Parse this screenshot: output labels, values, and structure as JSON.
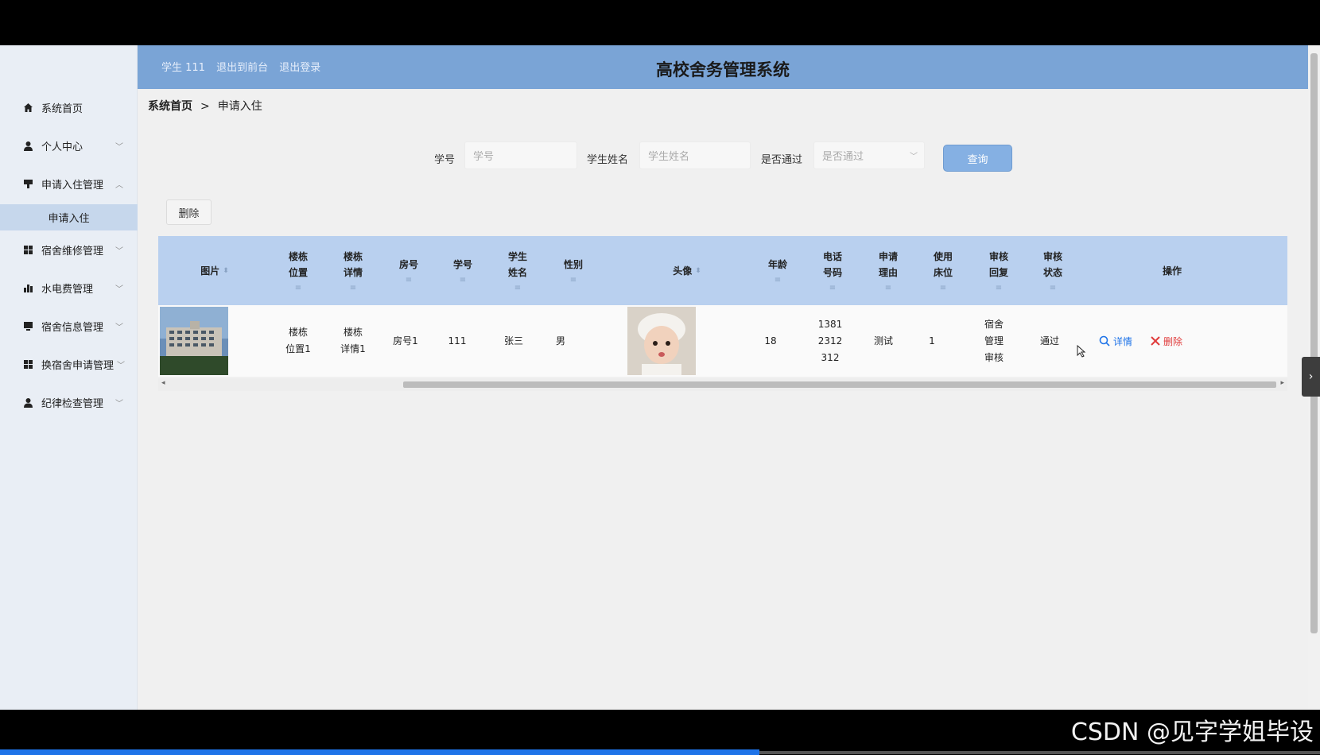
{
  "header": {
    "user_label": "学生 111",
    "back_link": "退出到前台",
    "logout_link": "退出登录",
    "title": "高校舍务管理系统"
  },
  "sidebar": {
    "items": [
      {
        "label": "系统首页",
        "icon": "home-icon"
      },
      {
        "label": "个人中心",
        "icon": "user-icon"
      },
      {
        "label": "申请入住管理",
        "icon": "bookmark-icon"
      },
      {
        "label": "宿舍维修管理",
        "icon": "grid-icon"
      },
      {
        "label": "水电费管理",
        "icon": "bar-chart-icon"
      },
      {
        "label": "宿舍信息管理",
        "icon": "monitor-icon"
      },
      {
        "label": "换宿舍申请管理",
        "icon": "grid-icon"
      },
      {
        "label": "纪律检查管理",
        "icon": "user-icon"
      }
    ],
    "active_sub": "申请入住"
  },
  "breadcrumb": {
    "home": "系统首页",
    "separator": ">",
    "current": "申请入住"
  },
  "search": {
    "student_id_label": "学号",
    "student_id_placeholder": "学号",
    "student_name_label": "学生姓名",
    "student_name_placeholder": "学生姓名",
    "passed_label": "是否通过",
    "passed_placeholder": "是否通过",
    "query_button": "查询"
  },
  "toolbar": {
    "delete_button": "删除"
  },
  "table": {
    "headers": {
      "image": "图片",
      "building_location": [
        "楼栋",
        "位置"
      ],
      "building_detail": [
        "楼栋",
        "详情"
      ],
      "room": "房号",
      "student_id": "学号",
      "student_name": [
        "学生",
        "姓名"
      ],
      "gender": "性别",
      "avatar": "头像",
      "age": "年龄",
      "phone": [
        "电话",
        "号码"
      ],
      "reason": [
        "申请",
        "理由"
      ],
      "bed": [
        "使用",
        "床位"
      ],
      "review_reply": [
        "审核",
        "回复"
      ],
      "review_status": [
        "审核",
        "状态"
      ],
      "actions": "操作"
    },
    "rows": [
      {
        "building_location": [
          "楼栋",
          "位置1"
        ],
        "building_detail": [
          "楼栋",
          "详情1"
        ],
        "room": "房号1",
        "student_id": "111",
        "student_name": "张三",
        "gender": "男",
        "age": "18",
        "phone": [
          "1381",
          "2312",
          "312"
        ],
        "reason": "测试",
        "bed": "1",
        "review_reply": [
          "宿舍",
          "管理",
          "审核"
        ],
        "review_status": "通过",
        "detail_action": "详情",
        "delete_action": "删除"
      }
    ]
  },
  "watermark": "CSDN @见字学姐毕设",
  "colors": {
    "header_bg": "#7aa4d6",
    "table_header_bg": "#b9d0ef",
    "link_blue": "#1e73e8",
    "delete_red": "#e03c3c"
  }
}
